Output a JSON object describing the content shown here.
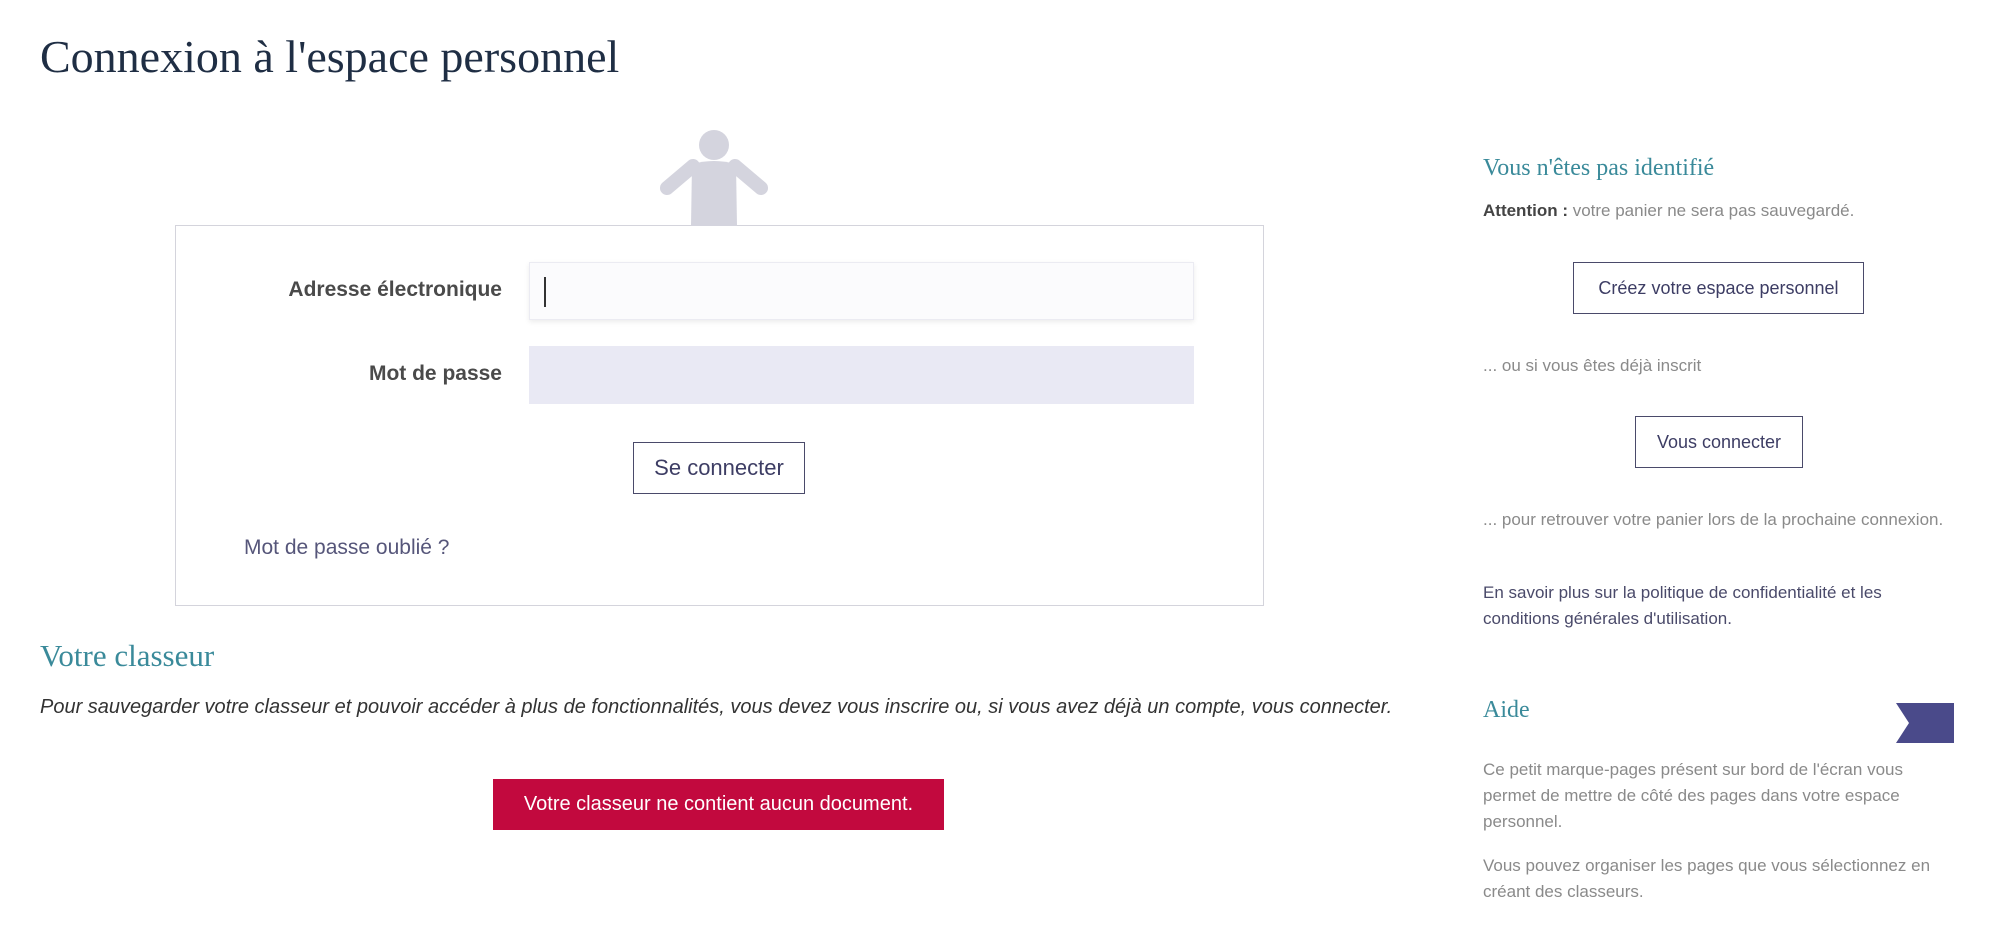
{
  "page": {
    "title": "Connexion à l'espace personnel"
  },
  "login": {
    "email_label": "Adresse électronique",
    "email_value": "",
    "password_label": "Mot de passe",
    "password_value": "",
    "submit_label": "Se connecter",
    "forgot_label": "Mot de passe oublié ?",
    "avatar_icon": "user-icon"
  },
  "binder": {
    "title": "Votre classeur",
    "text": "Pour sauvegarder votre classeur et pouvoir accéder à plus de fonctionnalités, vous devez vous inscrire ou, si vous avez déjà un compte, vous connecter.",
    "empty_label": "Votre classeur ne contient aucun document.",
    "empty_color": "#c2093e"
  },
  "sidebar": {
    "title": "Vous n'êtes pas identifié",
    "attention_label": "Attention :",
    "attention_text": " votre panier ne sera pas sauvegardé.",
    "create_label": "Créez votre espace personnel",
    "or_text": "... ou si vous êtes déjà inscrit",
    "connect_label": "Vous connecter",
    "retrieve_text": "... pour retrouver votre panier lors de la prochaine connexion.",
    "privacy_text": "En savoir plus sur la politique de confidentialité et les conditions générales d'utilisation."
  },
  "help": {
    "title": "Aide",
    "bookmark_icon": "bookmark-icon",
    "bookmark_color": "#4a4a8a",
    "text1": "Ce petit marque-pages présent sur bord de l'écran vous permet de mettre de côté des pages dans votre espace personnel.",
    "text2": "Vous pouvez organiser les pages que vous sélectionnez en créant des classeurs."
  },
  "colors": {
    "accent": "#3a8a9a",
    "title": "#1f2e44",
    "button_border": "#4a4a6a"
  }
}
